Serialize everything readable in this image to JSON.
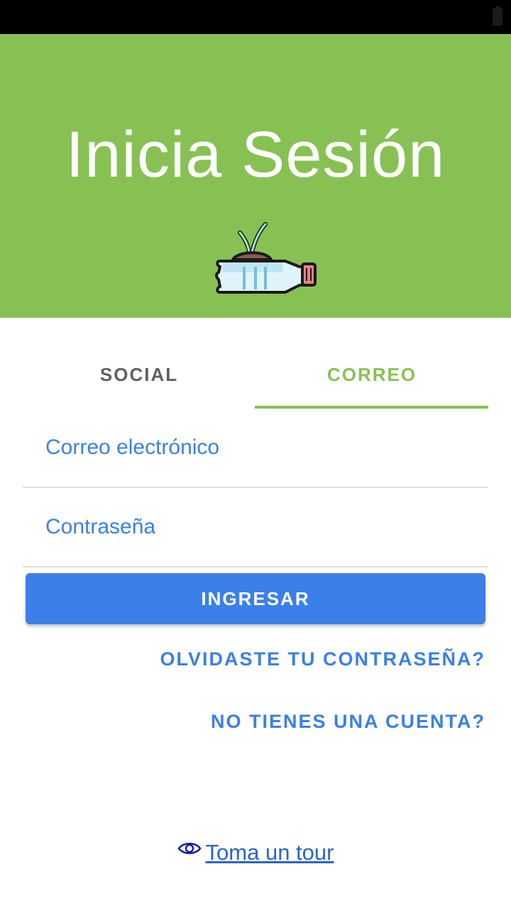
{
  "colors": {
    "header_bg": "#88c153",
    "accent_green": "#88c153",
    "primary_blue": "#3b7fe8",
    "link_blue": "#3b7fe8",
    "tour_link": "#2a63d1",
    "eye_icon": "#1a1aa6"
  },
  "header": {
    "title": "Inicia Sesión",
    "logo_icon": "plant-in-bottle-icon"
  },
  "tabs": [
    {
      "label": "SOCIAL",
      "selected": false
    },
    {
      "label": "CORREO",
      "selected": true
    }
  ],
  "form": {
    "email_placeholder": "Correo electrónico",
    "email_value": "",
    "password_placeholder": "Contraseña",
    "password_value": "",
    "submit_label": "INGRESAR"
  },
  "links": {
    "forgot_password": "OLVIDASTE TU CONTRASEÑA?",
    "no_account": "NO TIENES UNA CUENTA?"
  },
  "tour": {
    "icon": "eye-icon",
    "label": "Toma un tour"
  }
}
